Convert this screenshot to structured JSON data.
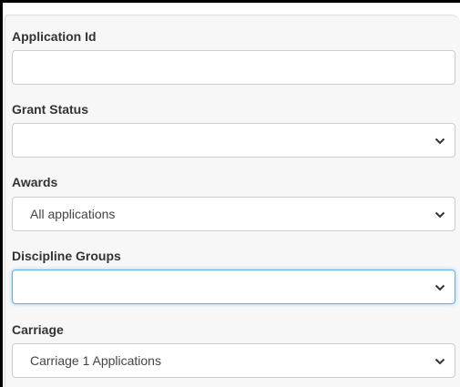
{
  "form": {
    "application_id": {
      "label": "Application Id",
      "value": ""
    },
    "grant_status": {
      "label": "Grant Status",
      "selected": ""
    },
    "awards": {
      "label": "Awards",
      "selected": "All applications"
    },
    "discipline_groups": {
      "label": "Discipline Groups",
      "selected": ""
    },
    "carriage": {
      "label": "Carriage",
      "selected": "Carriage 1 Applications"
    }
  },
  "icons": {
    "select_arrow": "chevron-down-icon"
  },
  "colors": {
    "focus_border": "#66afe9",
    "label_text": "#333333",
    "panel_bg": "#f7f7f7"
  }
}
